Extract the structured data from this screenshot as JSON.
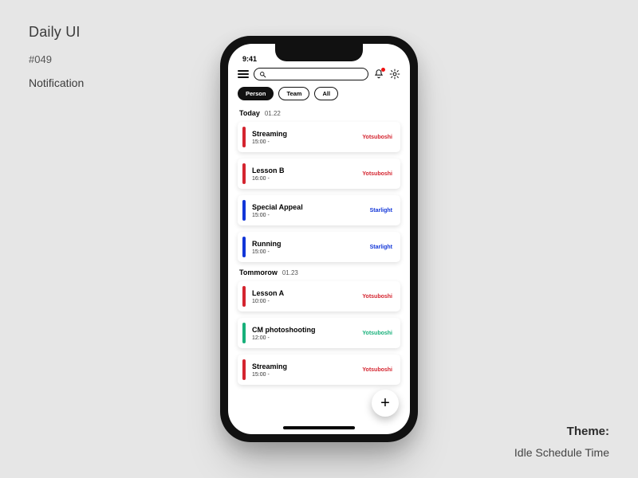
{
  "meta": {
    "project": "Daily UI",
    "number": "#049",
    "name": "Notification"
  },
  "theme": {
    "label": "Theme:",
    "value": "Idle Schedule Time"
  },
  "status": {
    "time": "9:41"
  },
  "filters": [
    {
      "label": "Person",
      "active": true
    },
    {
      "label": "Team",
      "active": false
    },
    {
      "label": "All",
      "active": false
    }
  ],
  "tags": {
    "yotsuboshi": {
      "text": "Yotsuboshi",
      "color": "#d4242f"
    },
    "starlight": {
      "text": "Starlight",
      "color": "#1236d8"
    },
    "green": {
      "text": "Yotsuboshi",
      "color": "#17b07a"
    }
  },
  "sections": [
    {
      "label": "Today",
      "date": "01.22",
      "items": [
        {
          "title": "Streaming",
          "time": "15:00 -",
          "stripe": "#d4242f",
          "tagText": "Yotsuboshi",
          "tagColor": "#d4242f"
        },
        {
          "title": "Lesson B",
          "time": "16:00 -",
          "stripe": "#d4242f",
          "tagText": "Yotsuboshi",
          "tagColor": "#d4242f"
        },
        {
          "title": "Special Appeal",
          "time": "15:00 -",
          "stripe": "#1236d8",
          "tagText": "Starlight",
          "tagColor": "#1236d8"
        },
        {
          "title": "Running",
          "time": "15:00 -",
          "stripe": "#1236d8",
          "tagText": "Starlight",
          "tagColor": "#1236d8"
        }
      ]
    },
    {
      "label": "Tommorow",
      "date": "01.23",
      "items": [
        {
          "title": "Lesson A",
          "time": "10:00 -",
          "stripe": "#d4242f",
          "tagText": "Yotsuboshi",
          "tagColor": "#d4242f"
        },
        {
          "title": "CM photoshooting",
          "time": "12:00 -",
          "stripe": "#17b07a",
          "tagText": "Yotsuboshi",
          "tagColor": "#17b07a"
        },
        {
          "title": "Streaming",
          "time": "15:00 -",
          "stripe": "#d4242f",
          "tagText": "Yotsuboshi",
          "tagColor": "#d4242f"
        }
      ]
    }
  ],
  "fab": "+"
}
